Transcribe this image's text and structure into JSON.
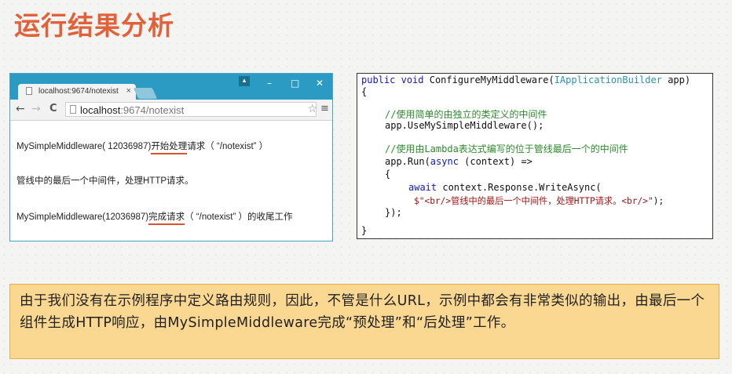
{
  "slide": {
    "title": "运行结果分析"
  },
  "browser": {
    "tab_title": "localhost:9674/notexist",
    "tab_close": "×",
    "profile_icon": "person-icon",
    "window_controls": {
      "minimize": "–",
      "maximize": "□",
      "close": "✕"
    },
    "nav": {
      "back": "←",
      "forward": "→",
      "reload": "C"
    },
    "address_host": "localhost",
    "address_path": ":9674/notexist",
    "star": "☆",
    "menu": "≡",
    "content": {
      "line1_prefix": "MySimpleMiddleware( 12036987)",
      "line1_highlight": "开始处理",
      "line1_suffix": "请求（ “/notexist” ）",
      "line2": "管线中的最后一个中间件，处理HTTP请求。",
      "line3_prefix": "MySimpleMiddleware(12036987)",
      "line3_highlight": "完成请求",
      "line3_suffix": "（ “/notexist” ）的收尾工作"
    },
    "accent_color": "#2b9bc4",
    "underline_color": "#d9532c"
  },
  "code": {
    "l1_kw1": "public",
    "l1_kw2": "void",
    "l1_name": "ConfigureMyMiddleware(",
    "l1_type": "IApplicationBuilder",
    "l1_rest": " app)",
    "l2": "{",
    "l3_comment": "//使用简单的由独立的类定义的中间件",
    "l4": "app.UseMySimpleMiddleware();",
    "l5_comment": "//使用由Lambda表达式编写的位于管线最后一个的中间件",
    "l6_a": "app.Run(",
    "l6_kw": "async",
    "l6_b": " (context) =>",
    "l7": "{",
    "l8_kw": "await",
    "l8_rest": " context.Response.WriteAsync(",
    "l9_str": "$\"<br/>管线中的最后一个中间件，处理HTTP请求。<br/>\"",
    "l9_rest": ");",
    "l10": "});",
    "l11": "}"
  },
  "note": {
    "text": "由于我们没有在示例程序中定义路由规则，因此，不管是什么URL，示例中都会有非常类似的输出，由最后一个组件生成HTTP响应，由MySimpleMiddleware完成“预处理”和“后处理”工作。",
    "background": "#fbd891"
  }
}
